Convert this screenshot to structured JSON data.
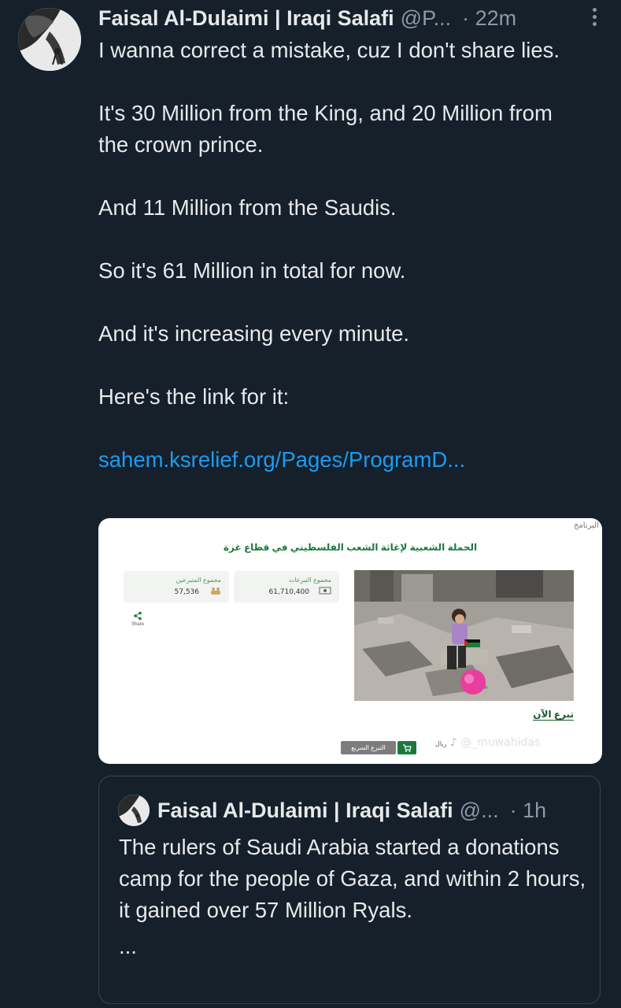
{
  "tweet": {
    "author_name": "Faisal Al-Dulaimi | Iraqi Salafi",
    "handle": "@P...",
    "time": "· 22m",
    "paragraphs": [
      "I wanna correct a mistake, cuz I don't share lies.",
      "It's 30 Million from the King, and 20 Million from the crown prince.",
      "And 11 Million from the Saudis.",
      "So it's 61 Million in total for now.",
      "And it's increasing every minute.",
      "Here's the link for it:"
    ],
    "link": "sahem.ksrelief.org/Pages/ProgramD...",
    "more_icon": "vertical-dots-icon"
  },
  "card": {
    "corner_label": "البرنامج",
    "title": "الحملة الشعبية لإغاثة الشعب الفلسطيني في قطاع غزة",
    "donors_label": "مجموع المتبرعين",
    "donors_value": "57,536",
    "donations_label": "مجموع التبرعات",
    "donations_value": "61,710,400",
    "share_label": "Share",
    "donate_now": "تبرع الآن",
    "quick_donate": "التبرع السريع",
    "watermark": "@_muwahidas",
    "watermark_prefix": "ريال",
    "share_icon": "share-icon",
    "cart_icon": "cart-icon",
    "people_icon": "people-icon",
    "money_icon": "money-icon"
  },
  "quoted": {
    "author_name": "Faisal Al-Dulaimi | Iraqi Salafi",
    "handle": "@...",
    "time": "· 1h",
    "text": "The rulers of Saudi Arabia started a donations camp for the people of Gaza, and within 2 hours, it gained over 57 Million Ryals.",
    "ellipsis": "..."
  },
  "colors": {
    "background": "#15202b",
    "text": "#e7e9ea",
    "muted": "#8b98a5",
    "link": "#1d9bf0",
    "card_green": "#1b7a3a"
  }
}
